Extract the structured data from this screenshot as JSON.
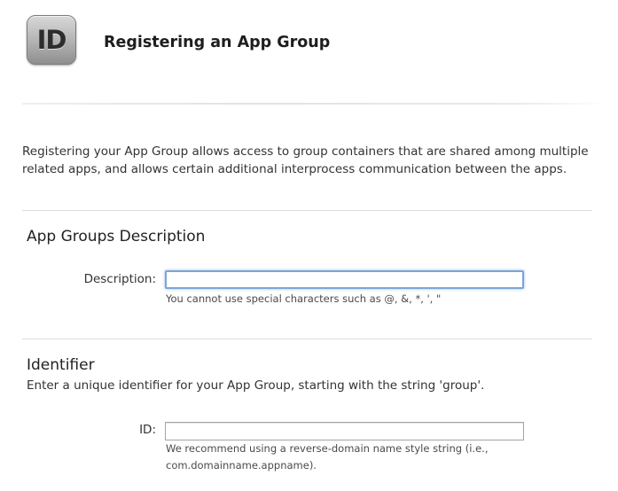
{
  "header": {
    "icon": {
      "name": "app-id-icon",
      "text": "ID"
    },
    "title": "Registering an App Group"
  },
  "intro": {
    "text": "Registering your App Group allows access to group containers that are shared among multiple related apps, and allows certain additional interprocess communication between the apps."
  },
  "description_section": {
    "title": "App Groups Description",
    "label": "Description:",
    "value": "",
    "hint": "You cannot use special characters such as @, &, *, ', \""
  },
  "identifier_section": {
    "title": "Identifier",
    "subtitle": "Enter a unique identifier for your App Group, starting with the string 'group'.",
    "label": "ID:",
    "value": "",
    "hint": "We recommend using a reverse-domain name style string (i.e., com.domainname.appname)."
  },
  "colors": {
    "focus_ring": "#7aa6d9",
    "divider": "#dddddd"
  }
}
